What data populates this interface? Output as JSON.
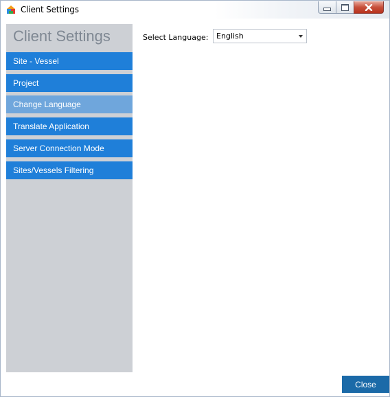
{
  "window": {
    "title": "Client Settings",
    "controls": {
      "minimize": "minimize",
      "maximize": "maximize",
      "close": "x"
    }
  },
  "sidebar": {
    "title": "Client Settings",
    "items": [
      {
        "label": "Site - Vessel",
        "active": false
      },
      {
        "label": "Project",
        "active": false
      },
      {
        "label": "Change Language",
        "active": true
      },
      {
        "label": "Translate Application",
        "active": false
      },
      {
        "label": "Server Connection Mode",
        "active": false
      },
      {
        "label": "Sites/Vessels Filtering",
        "active": false
      }
    ]
  },
  "main": {
    "language_label": "Select Language:",
    "language_value": "English"
  },
  "footer": {
    "close_label": "Close"
  },
  "colors": {
    "nav_item": "#1f7fd9",
    "nav_item_active": "#6fa6dc",
    "sidebar_bg": "#cdd0d5",
    "close_button": "#1b6aa8"
  }
}
